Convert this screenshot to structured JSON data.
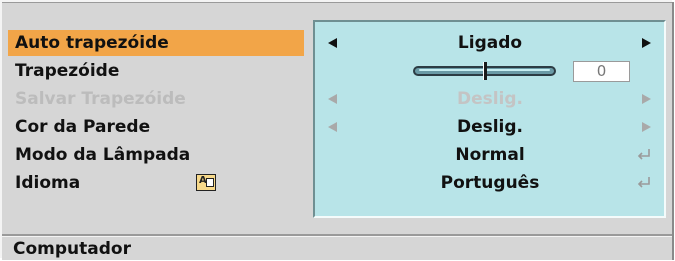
{
  "menu": {
    "items": [
      {
        "label": "Auto trapezóide",
        "state": "selected"
      },
      {
        "label": "Trapezóide",
        "state": "normal"
      },
      {
        "label": "Salvar Trapezóide",
        "state": "disabled"
      },
      {
        "label": "Cor da Parede",
        "state": "normal"
      },
      {
        "label": "Modo da Lâmpada",
        "state": "normal"
      },
      {
        "label": "Idioma",
        "state": "normal",
        "icon": "language-icon"
      }
    ]
  },
  "values": {
    "auto_keystone": "Ligado",
    "keystone_value": "0",
    "keystone_level": 0.5,
    "save_keystone": "Deslig.",
    "wall_color": "Deslig.",
    "lamp_mode": "Normal",
    "language": "Português"
  },
  "bottom_bar": {
    "label": "Computador"
  },
  "colors": {
    "background": "#d6d6d6",
    "selected": "#f2a548",
    "panel": "#b8e4e8"
  }
}
